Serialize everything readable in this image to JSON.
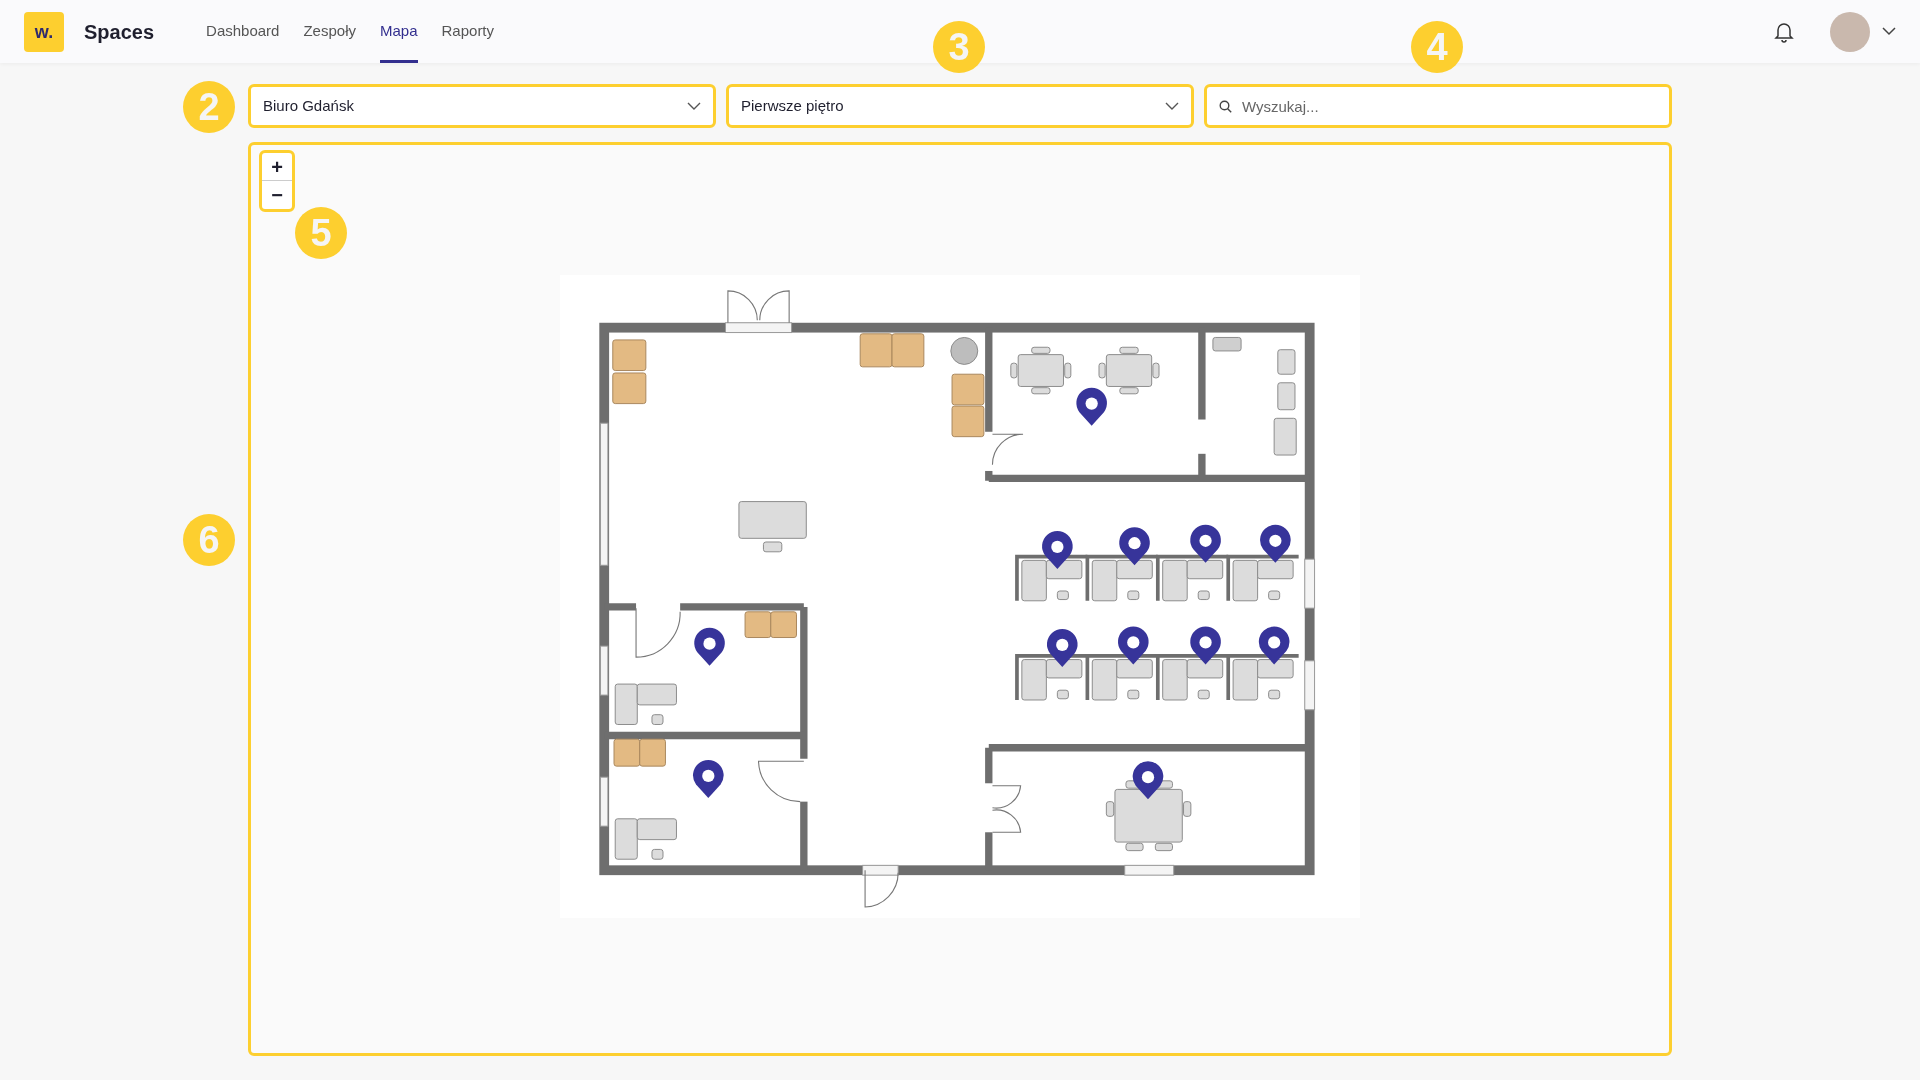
{
  "header": {
    "logo": "w.",
    "app_name": "Spaces",
    "nav": [
      {
        "label": "Dashboard",
        "selected": false
      },
      {
        "label": "Zespoły",
        "selected": false
      },
      {
        "label": "Mapa",
        "selected": true
      },
      {
        "label": "Raporty",
        "selected": false
      }
    ]
  },
  "filters": {
    "building": {
      "value": "Biuro Gdańsk",
      "callout": "2"
    },
    "floor": {
      "value": "Pierwsze piętro",
      "callout": "3"
    },
    "search": {
      "placeholder": "Wyszukaj...",
      "callout": "4"
    }
  },
  "map": {
    "callout": "6",
    "zoom": {
      "callout": "5",
      "buttons": [
        "+",
        "−"
      ]
    }
  }
}
